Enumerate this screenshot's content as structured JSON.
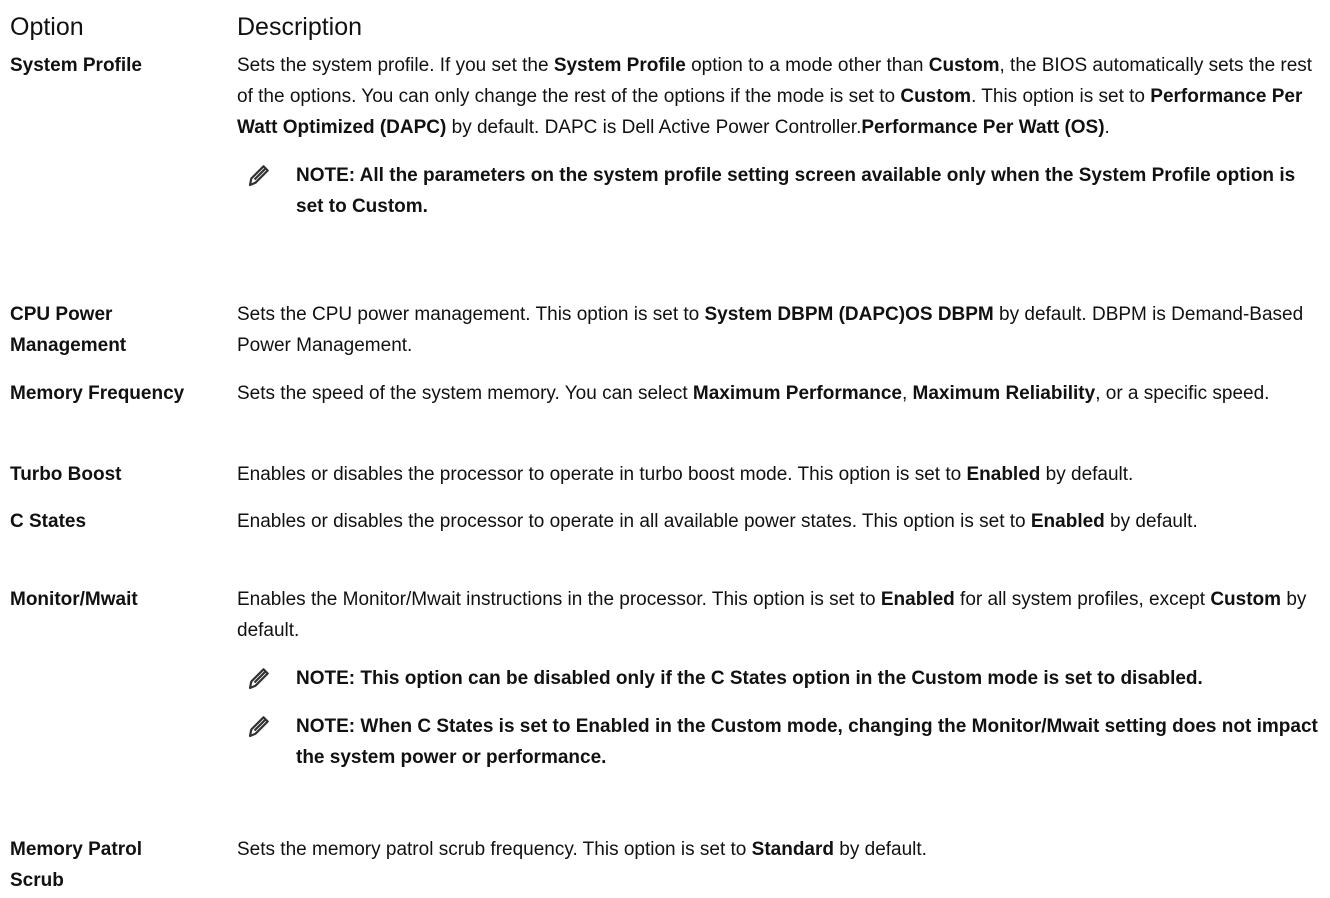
{
  "header": {
    "option": "Option",
    "description": "Description"
  },
  "rows": [
    {
      "option": "System Profile",
      "desc": [
        {
          "t": "Sets the system profile. If you set the "
        },
        {
          "t": "System Profile",
          "b": true
        },
        {
          "t": " option to a mode other than "
        },
        {
          "t": "Custom",
          "b": true
        },
        {
          "t": ", the BIOS automatically sets the rest of the options. You can only change the rest of the options if the mode is set to "
        },
        {
          "t": "Custom",
          "b": true
        },
        {
          "t": ". This option is set to "
        },
        {
          "t": "Performance Per Watt Optimized (DAPC)",
          "b": true
        },
        {
          "t": " by default. DAPC is Dell Active Power Controller."
        },
        {
          "t": "Performance Per Watt (OS)",
          "b": true
        },
        {
          "t": "."
        }
      ],
      "notes": [
        "NOTE: All the parameters on the system profile setting screen available only when the System Profile option is set to Custom."
      ]
    },
    {
      "option": "CPU Power Management",
      "desc": [
        {
          "t": "Sets the CPU power management. This option is set to "
        },
        {
          "t": "System DBPM (DAPC)OS DBPM",
          "b": true
        },
        {
          "t": " by default. DBPM is Demand-Based Power Management."
        }
      ],
      "notes": []
    },
    {
      "option": "Memory Frequency",
      "desc": [
        {
          "t": "Sets the speed of the system memory. You can select "
        },
        {
          "t": "Maximum Performance",
          "b": true
        },
        {
          "t": ", "
        },
        {
          "t": "Maximum Reliability",
          "b": true
        },
        {
          "t": ", or a specific speed."
        }
      ],
      "notes": []
    },
    {
      "option": "Turbo Boost",
      "desc": [
        {
          "t": "Enables or disables the processor to operate in turbo boost mode. This option is set to "
        },
        {
          "t": "Enabled",
          "b": true
        },
        {
          "t": " by default."
        }
      ],
      "notes": []
    },
    {
      "option": "C States",
      "desc": [
        {
          "t": "Enables or disables the processor to operate in all available power states. This option is set to "
        },
        {
          "t": "Enabled",
          "b": true
        },
        {
          "t": " by default."
        }
      ],
      "notes": []
    },
    {
      "option": "Monitor/Mwait",
      "desc": [
        {
          "t": "Enables the Monitor/Mwait instructions in the processor. This option is set to "
        },
        {
          "t": "Enabled",
          "b": true
        },
        {
          "t": " for all system profiles, except "
        },
        {
          "t": "Custom",
          "b": true
        },
        {
          "t": " by default."
        }
      ],
      "notes": [
        "NOTE: This option can be disabled only if the C States option in the Custom mode is set to disabled.",
        "NOTE: When C States is set to Enabled in the Custom mode, changing the Monitor/Mwait setting does not impact the system power or performance."
      ]
    },
    {
      "option": "Memory Patrol Scrub",
      "desc": [
        {
          "t": "Sets the memory patrol scrub frequency. This option is set to "
        },
        {
          "t": "Standard",
          "b": true
        },
        {
          "t": " by default."
        }
      ],
      "notes": []
    }
  ]
}
